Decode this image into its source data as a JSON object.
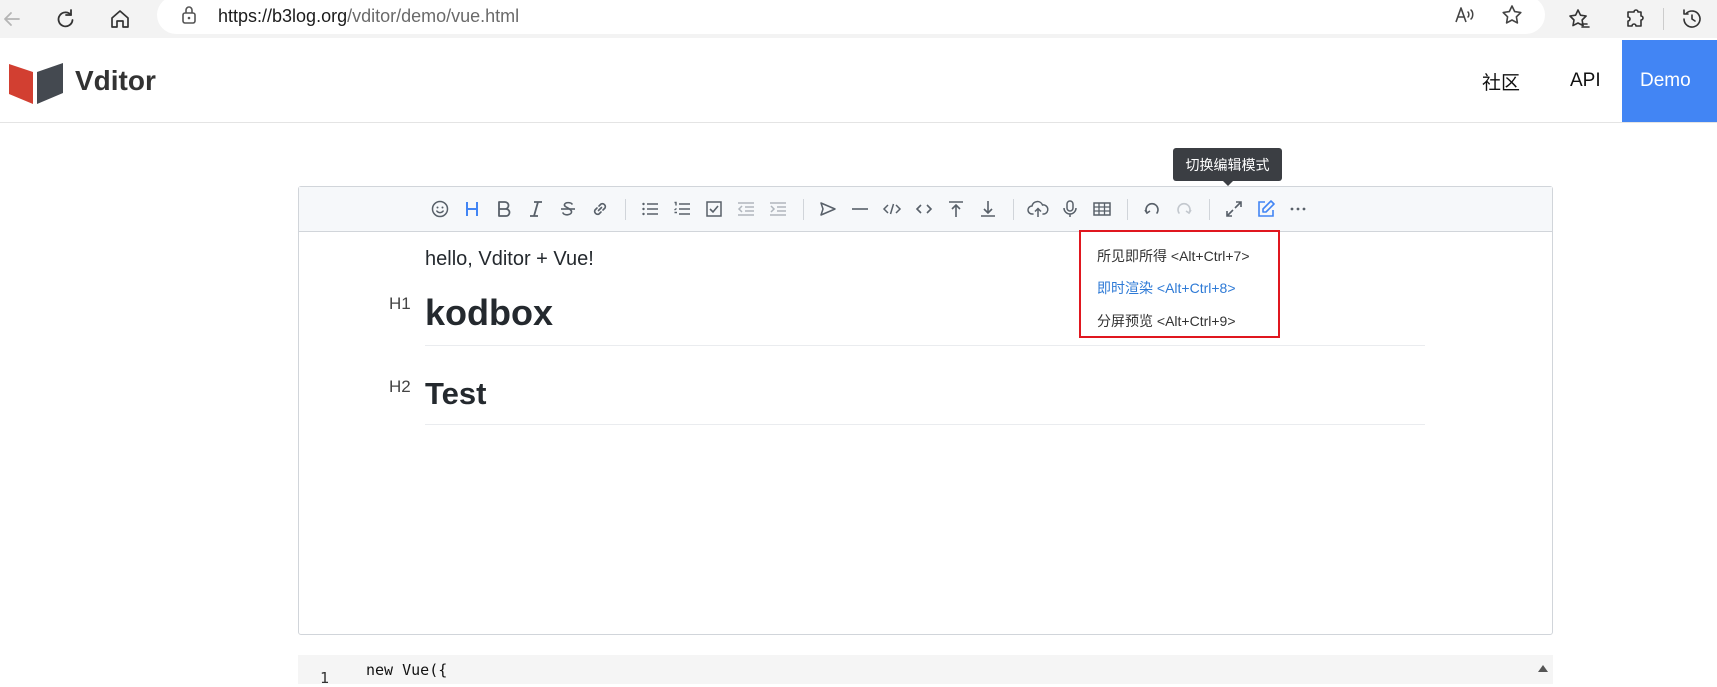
{
  "browser": {
    "url_host": "https://b3log.org",
    "url_path": "/vditor/demo/vue.html",
    "buttons": [
      "back-icon",
      "refresh-icon",
      "home-icon",
      "lock-icon",
      "read-aloud-icon",
      "favorite-icon",
      "favorites-icon",
      "extensions-icon",
      "history-icon"
    ]
  },
  "site": {
    "brand": "Vditor",
    "nav": [
      {
        "label": "社区"
      },
      {
        "label": "API"
      },
      {
        "label": "Demo"
      }
    ],
    "accent": "#4285f4"
  },
  "tooltip": {
    "text": "切换编辑模式"
  },
  "toolbar": {
    "buttons": [
      "emoji",
      "headings",
      "bold",
      "italic",
      "strike",
      "link",
      "list",
      "ordered-list",
      "check",
      "outdent",
      "indent",
      "quote",
      "line",
      "code",
      "inline-code",
      "insert-before",
      "insert-after",
      "upload",
      "record",
      "table",
      "undo",
      "redo",
      "fullscreen",
      "edit-mode",
      "more"
    ]
  },
  "editor": {
    "paragraph": "hello, Vditor + Vue!",
    "h1_marker": "H1",
    "h1": "kodbox",
    "h2_marker": "H2",
    "h2": "Test"
  },
  "mode_menu": {
    "items": [
      {
        "label": "所见即所得 <Alt+Ctrl+7>",
        "active": false
      },
      {
        "label": "即时渲染 <Alt+Ctrl+8>",
        "active": true
      },
      {
        "label": "分屏预览 <Alt+Ctrl+9>",
        "active": false
      }
    ],
    "highlight_color": "#e0171f",
    "active_color": "#2e7ad6"
  },
  "code_block": {
    "line_number": "1",
    "line_text": "new Vue({"
  }
}
